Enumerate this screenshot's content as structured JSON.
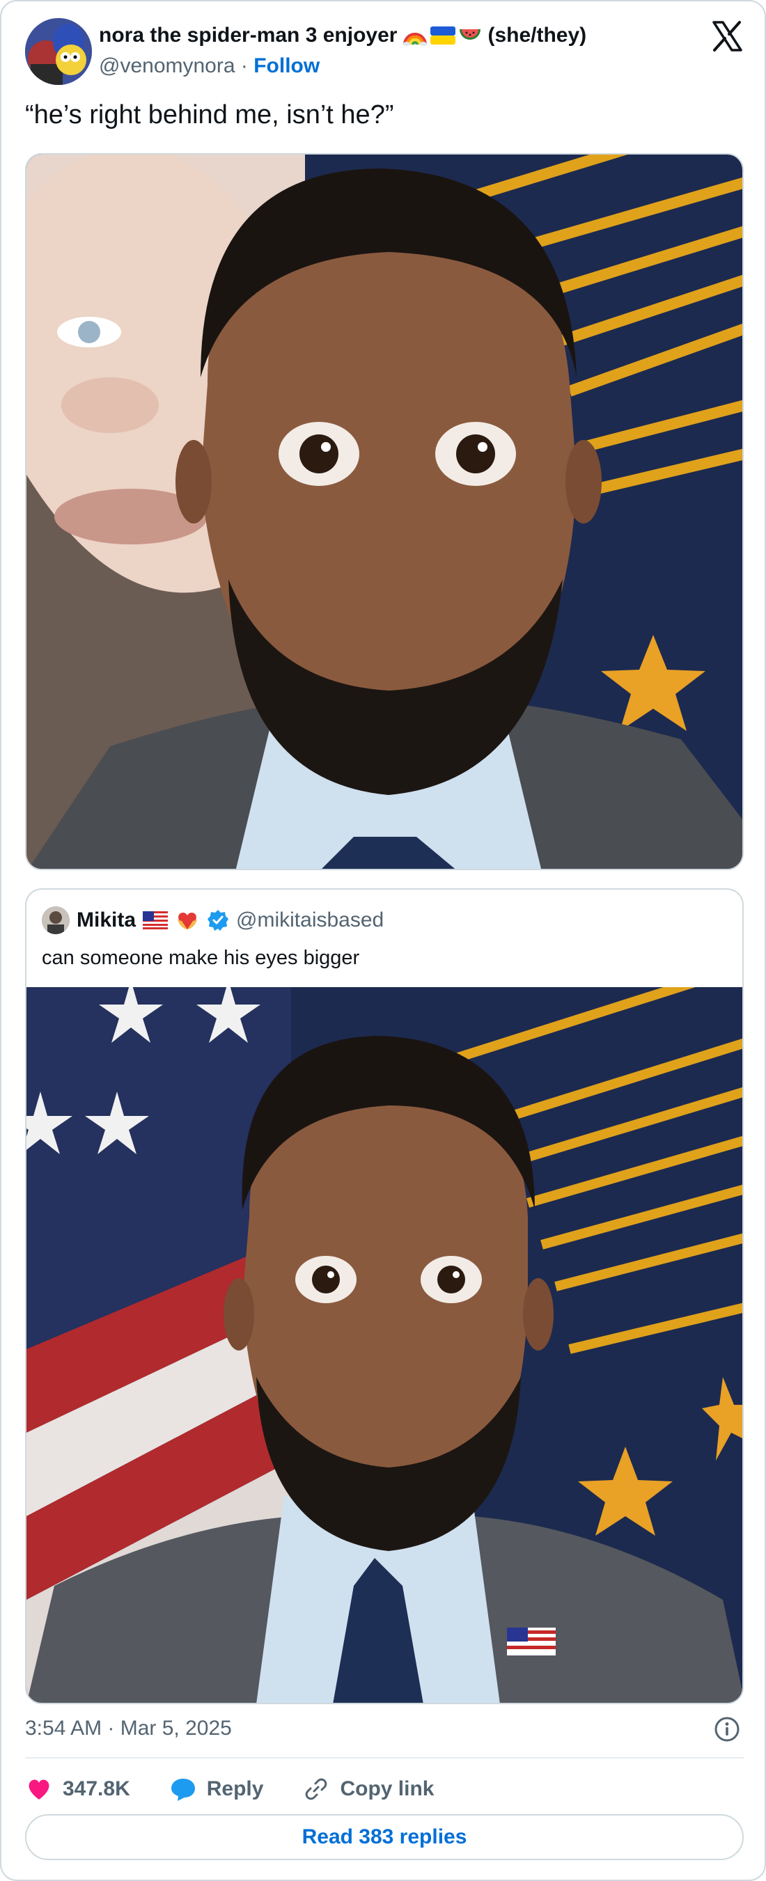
{
  "author": {
    "name": "nora the spider-man 3 enjoyer",
    "pronouns": "(she/they)",
    "handle": "@venomynora",
    "separator": "·",
    "follow_label": "Follow"
  },
  "tweet": {
    "text": "“he’s right behind me, isn’t he?”",
    "timestamp": "3:54 AM · Mar 5, 2025"
  },
  "quote": {
    "name": "Mikita",
    "handle": "@mikitaisbased",
    "text": "can someone make his eyes bigger"
  },
  "actions": {
    "likes": "347.8K",
    "reply_label": "Reply",
    "copy_label": "Copy link"
  },
  "read_replies_label": "Read 383 replies",
  "colors": {
    "link_blue": "#006fd6",
    "heart_pink": "#f91880",
    "reply_blue": "#1d9bf0",
    "muted": "#536471",
    "border": "#cfd9de"
  },
  "icons": [
    "x-logo-icon",
    "rainbow-icon",
    "ukraine-flag-icon",
    "watermelon-icon",
    "us-flag-icon",
    "heart-hands-icon",
    "verified-badge-icon",
    "info-icon",
    "heart-icon",
    "reply-icon",
    "link-icon"
  ]
}
